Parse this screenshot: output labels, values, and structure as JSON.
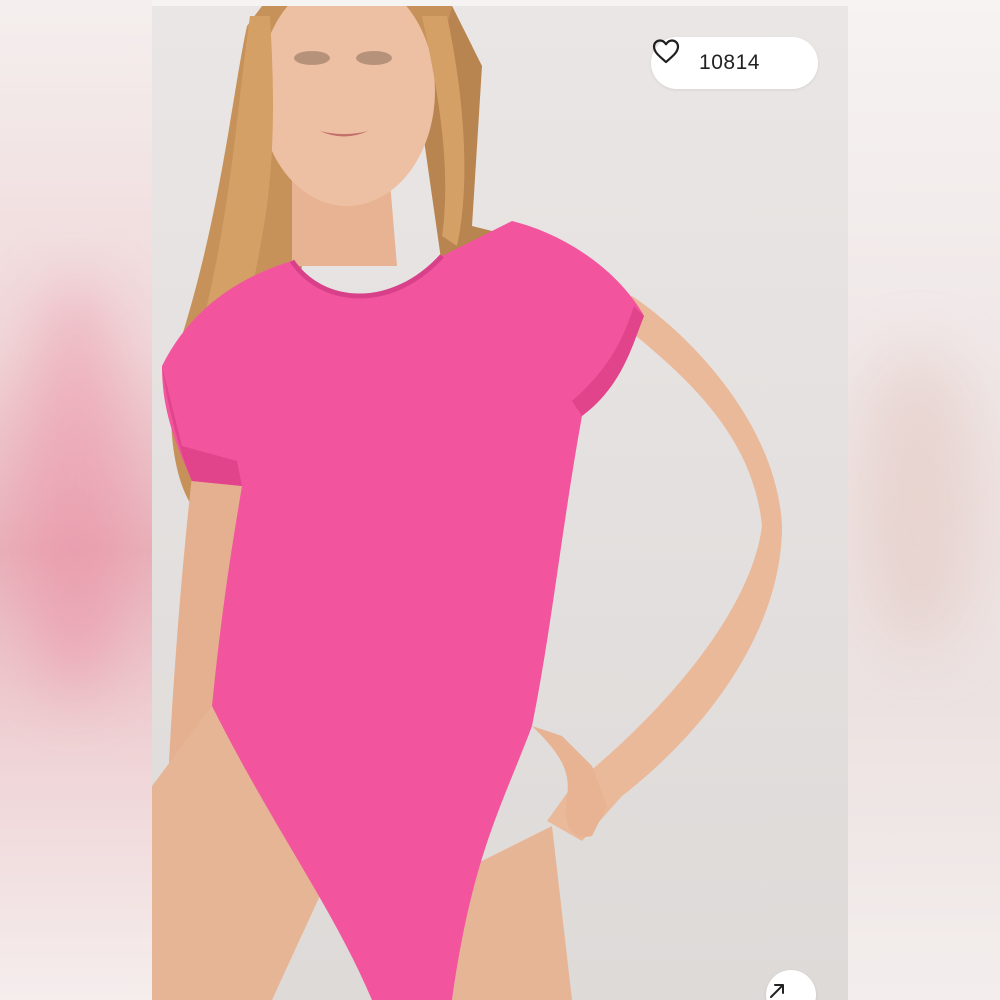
{
  "listing": {
    "like_count": "10814",
    "like_icon": "heart-outline-icon",
    "expand_icon": "expand-arrow-icon"
  },
  "colors": {
    "bodysuit": "#f2559d",
    "background": "#e6e3e2",
    "skin": "#eab99a",
    "hair": "#c7925a"
  }
}
